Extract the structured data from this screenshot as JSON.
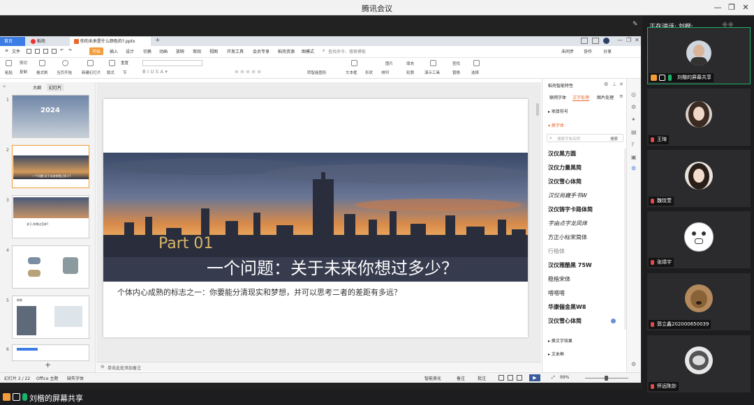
{
  "app_title": "腾讯会议",
  "meeting": {
    "speaking_label": "正在讲话: 刘楷;",
    "screen_share_label": "刘楷的屏幕共享",
    "participants": [
      {
        "name": "刘楷的屏幕共享"
      },
      {
        "name": "王琦"
      },
      {
        "name": "魏玟萱"
      },
      {
        "name": "张靖宇"
      },
      {
        "name": "郭立鑫202000650039"
      },
      {
        "name": "怀远陈妙"
      }
    ]
  },
  "wps": {
    "tabs": [
      {
        "label": "首页"
      },
      {
        "label": "稻壳"
      },
      {
        "label": "你的未来是什么颜色的?.pptx"
      }
    ],
    "menu": [
      "文件",
      "开始",
      "插入",
      "设计",
      "切换",
      "动画",
      "放映",
      "审阅",
      "视图",
      "开发工具",
      "会员专享",
      "稻壳资源",
      "图模式",
      "查找命令、搜索模板"
    ],
    "menu_right": [
      "未同步",
      "协作",
      "分享"
    ],
    "ribbon": {
      "paste": "粘贴",
      "cut": "剪切",
      "copy": "复制",
      "format_painter": "格式刷",
      "start_from": "当页开始",
      "new_slide": "新建幻灯片",
      "layout": "版式",
      "section": "节",
      "reset": "重置",
      "text_box": "文本框",
      "shape": "形状",
      "arrange": "排列",
      "picture": "图片",
      "fill": "填充",
      "outline": "轮廓",
      "presentation_tools": "演示工具",
      "find": "查找",
      "replace": "替换",
      "select": "选择",
      "convert_smartart": "转智能图形"
    },
    "thumbnail_tabs": [
      "大纲",
      "幻灯片"
    ],
    "slide_numbers": [
      "1",
      "2",
      "3",
      "4",
      "5",
      "6"
    ],
    "thumbnail_texts": {
      "t1_big": "2024",
      "t2_title": "一个问题:关于未来你想过多少?",
      "t3_title": "关于,你想过怎样?",
      "t5_title": "地铁"
    },
    "slide": {
      "part": "Part 01",
      "headline": "一个问题：关于未来你想过多少？",
      "body": "个体内心成熟的标志之一：你要能分清现实和梦想，并可以思考二者的差距有多远？"
    },
    "notes_placeholder": "单击此处添加备注",
    "right_panel": {
      "title": "稻壳智能特性",
      "tabs": [
        "联网字体",
        "文字处理",
        "图片处理"
      ],
      "section_project": "项目符号",
      "section_font": "换字体",
      "search_placeholder": "搜索字体名称",
      "search_button": "搜索",
      "fonts": [
        "汉仪黑方圆",
        "汉仪力量黑简",
        "汉仪雪心体简",
        "汉仪尚巍手书W",
        "汉仪铸字卡路体简",
        "字由点字龙凤体",
        "方正小标宋简体",
        "行楷体",
        "汉仪雅酷黑 75W",
        "稳楷宋体",
        "嗒嗒嗒",
        "华康俪金黑W8",
        "汉仪雪心体简"
      ],
      "section_effect": "换文字效果",
      "section_textbox": "文本框"
    },
    "status": {
      "slide_indicator": "幻灯片 2 / 22",
      "theme": "Office 主题",
      "missing_font": "缺失字体",
      "beautify": "智能美化",
      "notes": "备注",
      "comments": "批注",
      "zoom": "99%"
    }
  },
  "colors": {
    "accent_orange": "#f29b38",
    "meeting_bg": "#1d1d1f",
    "speaker_green": "#19b36b"
  }
}
